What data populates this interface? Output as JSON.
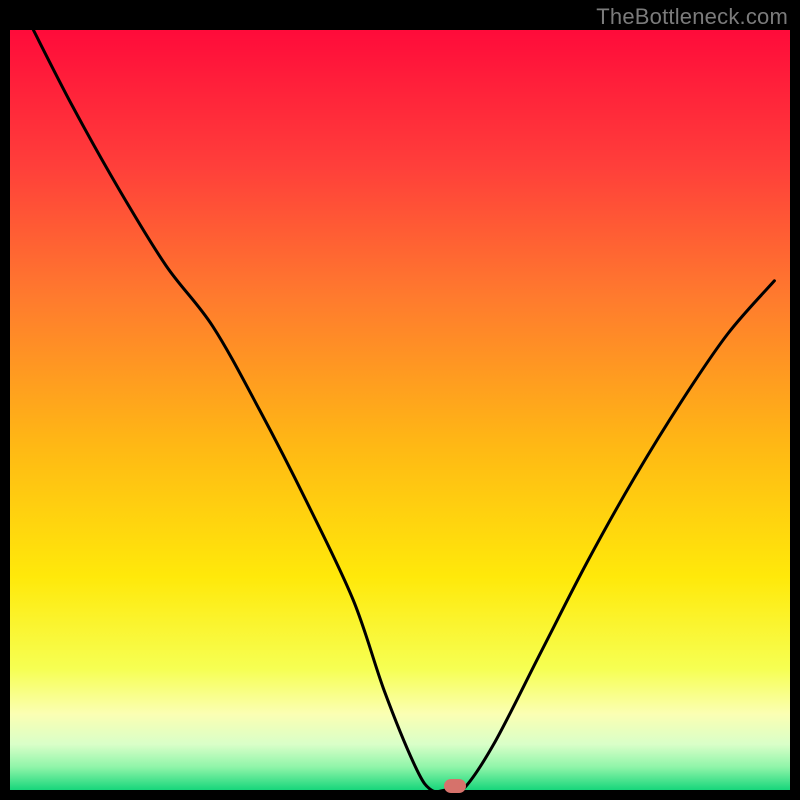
{
  "watermark": {
    "text": "TheBottleneck.com"
  },
  "chart_data": {
    "type": "line",
    "title": "",
    "xlabel": "",
    "ylabel": "",
    "xlim": [
      0,
      100
    ],
    "ylim": [
      0,
      100
    ],
    "grid": false,
    "legend": false,
    "background_gradient": {
      "type": "vertical",
      "stops": [
        {
          "pos": 0.0,
          "color": "#ff0b3a"
        },
        {
          "pos": 0.18,
          "color": "#ff3f3a"
        },
        {
          "pos": 0.35,
          "color": "#ff7a2e"
        },
        {
          "pos": 0.55,
          "color": "#ffb914"
        },
        {
          "pos": 0.72,
          "color": "#ffe90a"
        },
        {
          "pos": 0.84,
          "color": "#f6ff52"
        },
        {
          "pos": 0.9,
          "color": "#fbffb3"
        },
        {
          "pos": 0.94,
          "color": "#d9ffc8"
        },
        {
          "pos": 0.97,
          "color": "#8ff5a9"
        },
        {
          "pos": 1.0,
          "color": "#17d67b"
        }
      ]
    },
    "series": [
      {
        "name": "bottleneck-curve",
        "color": "#000000",
        "stroke_width": 3,
        "x": [
          3,
          8,
          14,
          20,
          26,
          32,
          38,
          44,
          48,
          52,
          54,
          56,
          58,
          62,
          68,
          74,
          80,
          86,
          92,
          98
        ],
        "y": [
          100,
          90,
          79,
          69,
          61,
          50,
          38,
          25,
          13,
          3,
          0,
          0,
          0,
          6,
          18,
          30,
          41,
          51,
          60,
          67
        ]
      }
    ],
    "markers": [
      {
        "name": "optimal-marker",
        "x": 57,
        "y": 0,
        "color": "#d6726b"
      }
    ]
  }
}
